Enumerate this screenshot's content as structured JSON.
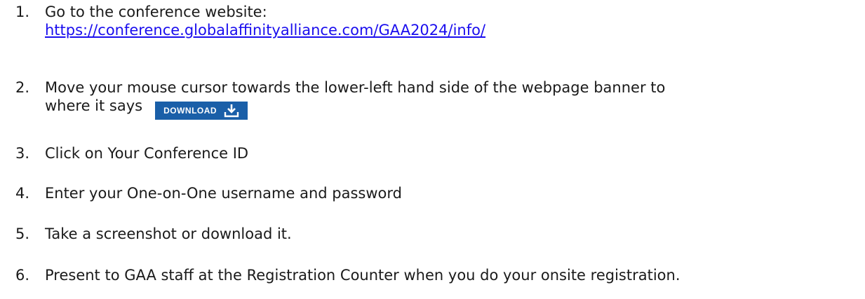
{
  "steps": [
    {
      "number": "1.",
      "text": "Go to the conference website:",
      "link": "https://conference.globalaffinityalliance.com/GAA2024/info/"
    },
    {
      "number": "2.",
      "text": "Move your mouse cursor towards the lower-left hand side of the webpage banner to",
      "text_cont": "where it says",
      "button_label": "DOWNLOAD",
      "button_icon": "download-icon"
    },
    {
      "number": "3.",
      "text": "Click on Your Conference ID"
    },
    {
      "number": "4.",
      "text": "Enter your One-on-One username and password"
    },
    {
      "number": "5.",
      "text": "Take a screenshot or download it."
    },
    {
      "number": "6.",
      "text": "Present to GAA staff at the Registration Counter when you do your onsite registration."
    }
  ],
  "colors": {
    "text": "#1a1a1a",
    "link": "#1a0dee",
    "button": "#1a5fa8"
  }
}
